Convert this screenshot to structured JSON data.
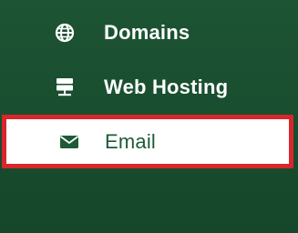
{
  "sidebar": {
    "items": [
      {
        "label": "Domains",
        "icon": "globe-icon"
      },
      {
        "label": "Web Hosting",
        "icon": "server-icon"
      },
      {
        "label": "Email",
        "icon": "envelope-icon",
        "active": true
      }
    ]
  },
  "colors": {
    "sidebar_bg": "#1d5434",
    "active_bg": "#ffffff",
    "active_text": "#1f5a37",
    "highlight_border": "#d9262c"
  }
}
